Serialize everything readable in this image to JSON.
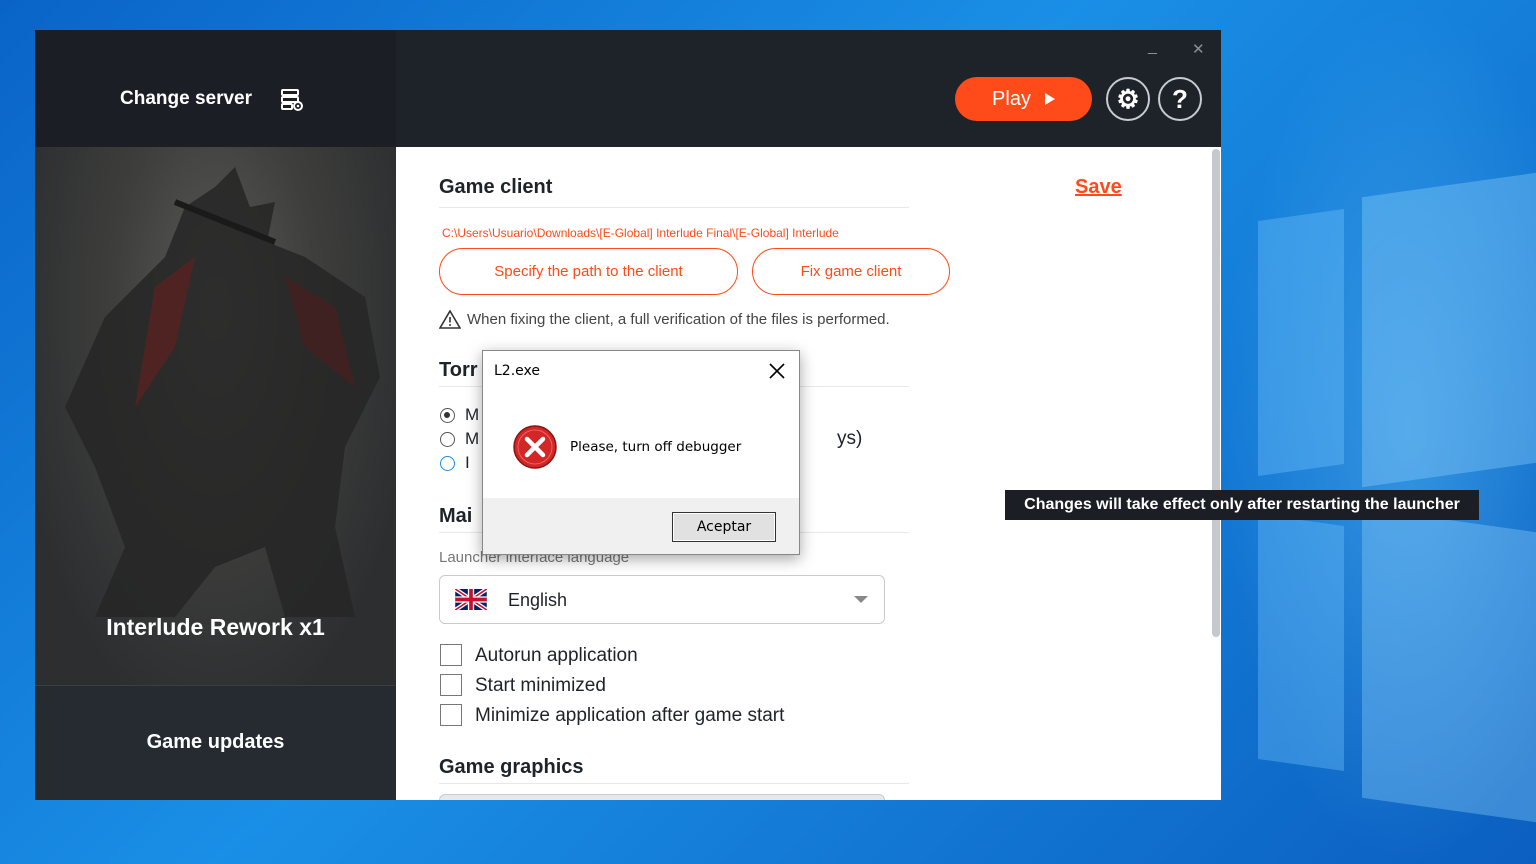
{
  "header": {
    "change_server": "Change server",
    "play_label": "Play",
    "settings_glyph": "⚙",
    "help_glyph": "?",
    "minimize_glyph": "_",
    "close_glyph": "✕"
  },
  "left": {
    "server_name": "Interlude Rework x1",
    "game_updates": "Game updates"
  },
  "settings": {
    "game_client_title": "Game client",
    "save_label": "Save",
    "client_path": "C:\\Users\\Usuario\\Downloads\\[E-Global] Interlude Final\\[E-Global] Interlude",
    "specify_path_button": "Specify the path to the client",
    "fix_client_button": "Fix game client",
    "fix_warning": "When fixing the client, a full verification of the files is performed.",
    "torrent_title_partial": "Torr",
    "radio_partials": [
      "M",
      "M",
      "I"
    ],
    "radio_trailing": "ys)",
    "main_title_partial": "Mai",
    "launcher_language_label": "Launcher interface language",
    "language_value": "English",
    "checkboxes": [
      "Autorun application",
      "Start minimized",
      "Minimize application after game start"
    ],
    "game_graphics_title": "Game graphics"
  },
  "tooltip": {
    "text": "Changes will take effect only after restarting the launcher"
  },
  "dialog": {
    "title": "L2.exe",
    "message": "Please, turn off debugger",
    "ok_button": "Aceptar"
  },
  "icons": {
    "server": "server-settings-icon",
    "play": "play-icon",
    "settings": "gear-icon",
    "help": "question-icon",
    "warning": "warning-icon",
    "error": "error-icon",
    "flag": "uk-flag-icon"
  },
  "colors": {
    "accent": "#ff4a1a",
    "dark": "#1e2329"
  }
}
